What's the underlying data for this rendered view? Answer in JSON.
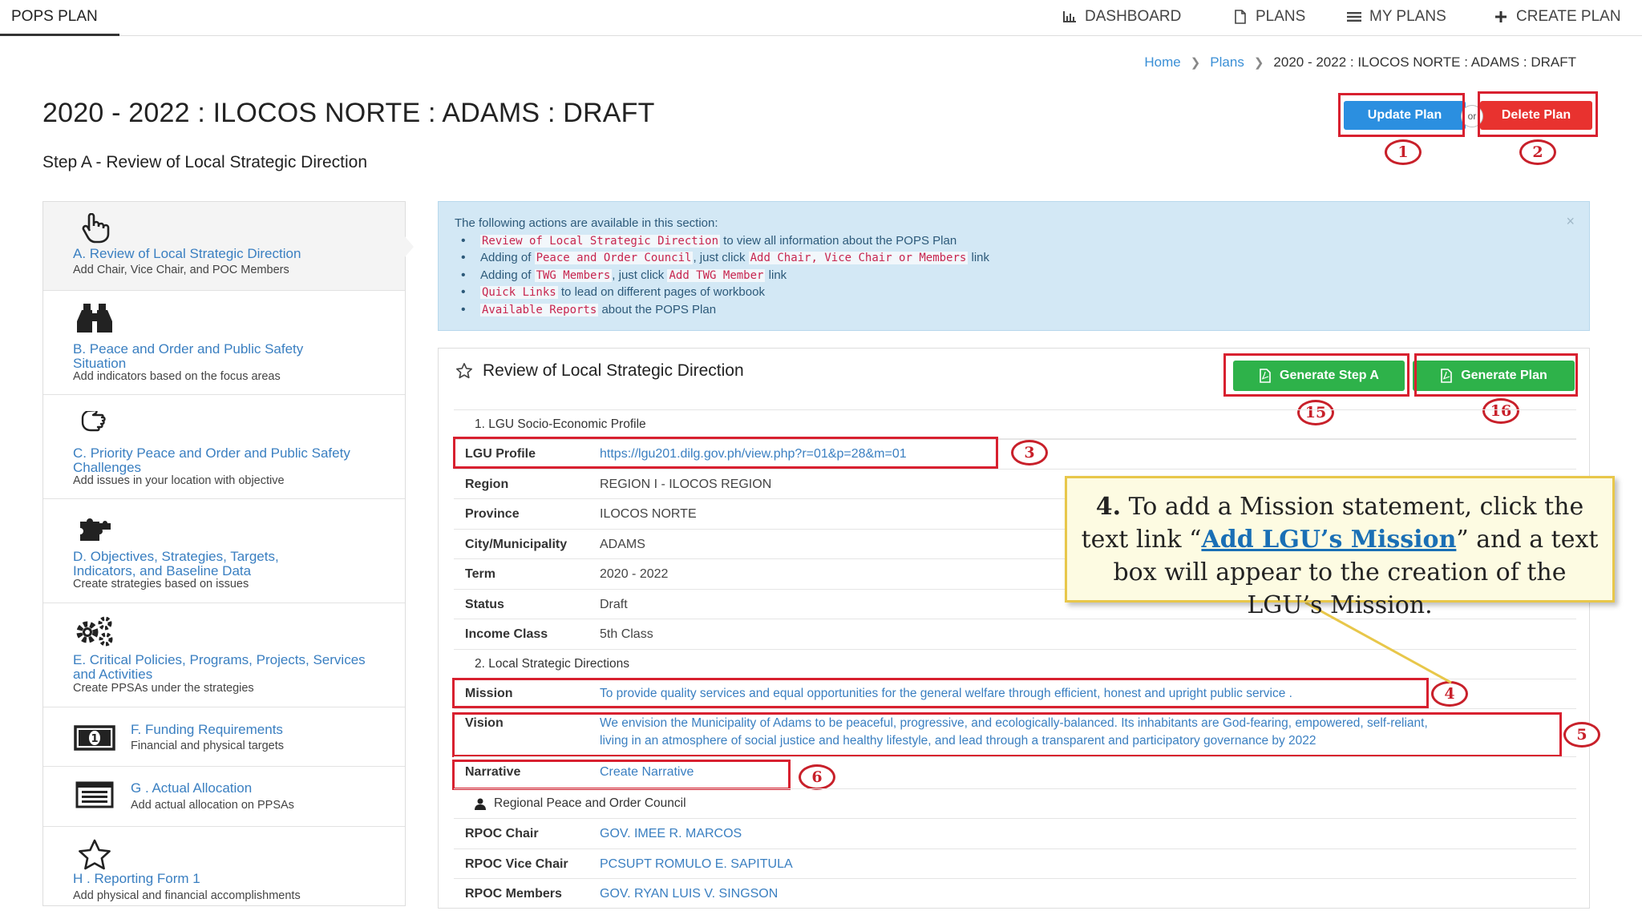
{
  "navbar": {
    "brand": "POPS PLAN",
    "items": [
      {
        "label": "DASHBOARD",
        "icon": "bar-chart-icon"
      },
      {
        "label": "PLANS",
        "icon": "file-icon"
      },
      {
        "label": "MY PLANS",
        "icon": "list-icon"
      },
      {
        "label": "CREATE PLAN",
        "icon": "plus-icon"
      }
    ]
  },
  "breadcrumb": {
    "home": "Home",
    "plans": "Plans",
    "current": "2020 - 2022 : ILOCOS NORTE : ADAMS : DRAFT"
  },
  "header": {
    "title": "2020 - 2022 : ILOCOS NORTE : ADAMS : DRAFT",
    "step": "Step A - Review of Local Strategic Direction",
    "update_label": "Update Plan",
    "or_label": "or",
    "delete_label": "Delete Plan"
  },
  "annotations": {
    "n1": "1",
    "n2": "2",
    "n3": "3",
    "n4": "4",
    "n5": "5",
    "n6": "6",
    "n15": "15",
    "n16": "16"
  },
  "sidebar": {
    "items": [
      {
        "label": "A. Review of Local Strategic Direction",
        "desc": "Add Chair, Vice Chair, and POC Members",
        "icon": "hand-pointer-icon"
      },
      {
        "label": "B. Peace and Order and Public Safety Situation",
        "desc": "Add indicators based on the focus areas",
        "icon": "binoculars-icon"
      },
      {
        "label": "C. Priority Peace and Order and Public Safety Challenges",
        "desc": "Add issues in your location with objective",
        "icon": "hand-paper-icon"
      },
      {
        "label": "D. Objectives, Strategies, Targets, Indicators, and Baseline Data",
        "desc": "Create strategies based on issues",
        "icon": "puzzle-icon"
      },
      {
        "label": "E. Critical Policies, Programs, Projects, Services and Activities",
        "desc": "Create PPSAs under the strategies",
        "icon": "gears-icon"
      },
      {
        "label": "F. Funding Requirements",
        "desc": "Financial and physical targets",
        "icon": "money-icon"
      },
      {
        "label": "G . Actual Allocation",
        "desc": "Add actual allocation on PPSAs",
        "icon": "list-alt-icon"
      },
      {
        "label": "H . Reporting Form 1",
        "desc": "Add physical and financial accomplishments",
        "icon": "star-icon"
      }
    ]
  },
  "alert": {
    "intro": "The following actions are available in this section:",
    "close": "×",
    "items": [
      {
        "c1": "Review of Local Strategic Direction",
        "t1": " to view all information about the POPS Plan"
      },
      {
        "t0": "Adding of ",
        "c1": "Peace and Order Council",
        "t1": ", just click ",
        "c2": "Add Chair, Vice Chair or Members",
        "t2": " link"
      },
      {
        "t0": "Adding of ",
        "c1": "TWG Members",
        "t1": ", just click ",
        "c2": "Add TWG Member",
        "t2": " link"
      },
      {
        "c1": "Quick Links",
        "t1": " to lead on different pages of workbook"
      },
      {
        "c1": "Available Reports",
        "t1": " about the POPS Plan"
      }
    ]
  },
  "panel": {
    "title": "Review of Local Strategic Direction",
    "gen_step_a": "Generate Step A",
    "gen_plan": "Generate Plan",
    "sections": {
      "s1": "1. LGU Socio-Economic Profile",
      "s2": "2. Local Strategic Directions",
      "s3": "Regional Peace and Order Council"
    },
    "rows": [
      {
        "label": "LGU Profile",
        "value": "https://lgu201.dilg.gov.ph/view.php?r=01&p=28&m=01"
      },
      {
        "label": "Region",
        "value": "REGION I - ILOCOS REGION"
      },
      {
        "label": "Province",
        "value": "ILOCOS NORTE"
      },
      {
        "label": "City/Municipality",
        "value": "ADAMS"
      },
      {
        "label": "Term",
        "value": "2020 - 2022"
      },
      {
        "label": "Status",
        "value": "Draft"
      },
      {
        "label": "Income Class",
        "value": "5th Class"
      },
      {
        "label": "Mission",
        "value": "To provide quality services and equal opportunities for the general welfare through efficient, honest and upright public service ."
      },
      {
        "label": "Vision",
        "value": "We envision the Municipality of Adams to be peaceful, progressive, and ecologically-balanced. Its inhabitants are God-fearing, empowered, self-reliant,",
        "value2": "living in an atmosphere of social justice and healthy lifestyle, and lead through a transparent and participatory governance by 2022"
      },
      {
        "label": "Narrative",
        "value": "Create Narrative"
      },
      {
        "label": "RPOC Chair",
        "value": "GOV. IMEE R. MARCOS"
      },
      {
        "label": "RPOC Vice Chair",
        "value": "PCSUPT ROMULO E. SAPITULA"
      },
      {
        "label": "RPOC Members",
        "value": "GOV. RYAN LUIS V. SINGSON"
      }
    ]
  },
  "callout": {
    "num": "4.",
    "t1": " To add a Mission statement, click the text link “",
    "link": "Add LGU’s Mission",
    "t2": "” and a text box will appear to the creation of the LGU’s Mission."
  }
}
